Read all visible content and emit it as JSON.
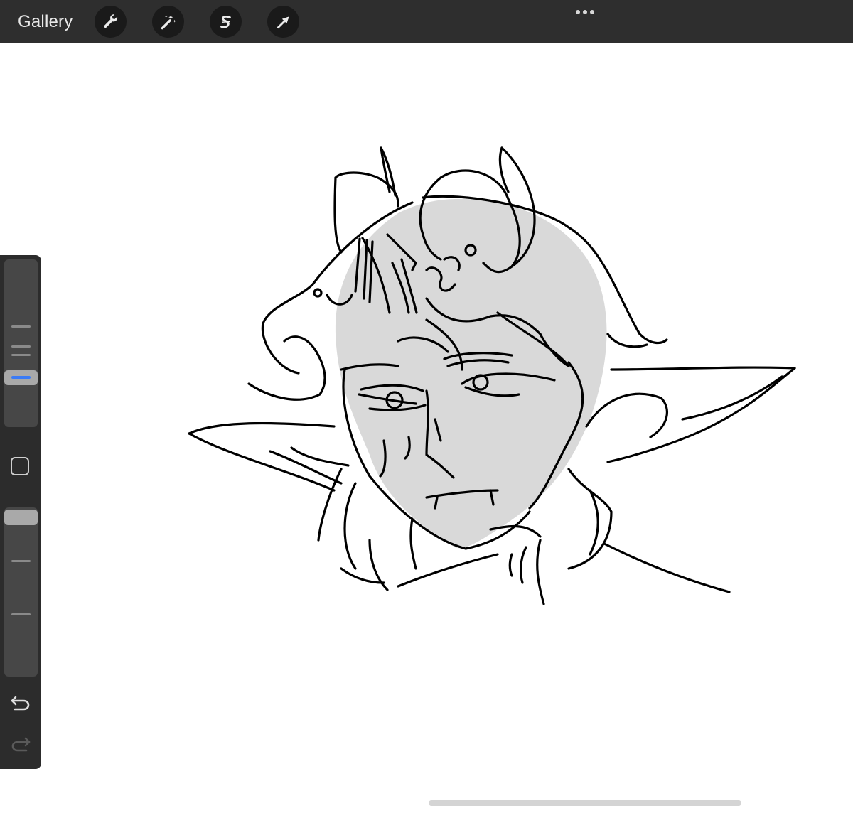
{
  "topbar": {
    "gallery_label": "Gallery",
    "tools": [
      {
        "name": "actions",
        "icon": "wrench-icon"
      },
      {
        "name": "adjustments",
        "icon": "magic-wand-icon"
      },
      {
        "name": "selection",
        "icon": "selection-s-icon"
      },
      {
        "name": "transform",
        "icon": "arrow-cursor-icon"
      }
    ],
    "more_icon": "more-dots-icon"
  },
  "sidebar": {
    "brush_size_slider": {
      "value": 0.31,
      "accent": "#3b7bf5"
    },
    "modify_button_icon": "square-outline-icon",
    "opacity_slider": {
      "value": 0.92
    },
    "undo_icon": "undo-arrow-icon",
    "redo_icon": "redo-arrow-icon"
  },
  "canvas": {
    "content": "sketch",
    "background": "#ffffff",
    "fill_color": "#d9d9d9",
    "stroke_color": "#000000"
  },
  "colors": {
    "topbar": "#2e2e2e",
    "tool_button": "#1a1a1a",
    "sidebar": "#2c2c2c",
    "accent": "#3b7bf5"
  }
}
